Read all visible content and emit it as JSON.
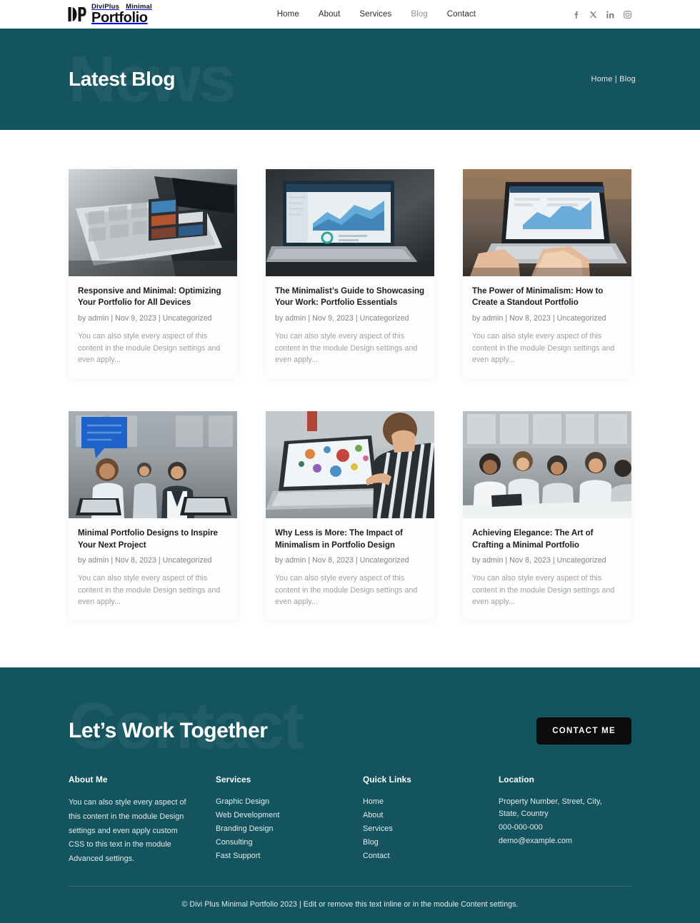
{
  "header": {
    "logo": {
      "mark": "ip-monogram-icon",
      "line1_a": "DiviPlus",
      "line1_b": "Minimal",
      "line2": "Portfolio"
    },
    "nav": [
      {
        "label": "Home",
        "active": false
      },
      {
        "label": "About",
        "active": false
      },
      {
        "label": "Services",
        "active": false
      },
      {
        "label": "Blog",
        "active": true
      },
      {
        "label": "Contact",
        "active": false
      }
    ],
    "socials": [
      {
        "name": "facebook-icon",
        "glyph": "f"
      },
      {
        "name": "x-twitter-icon",
        "glyph": "X"
      },
      {
        "name": "linkedin-icon",
        "glyph": "in"
      },
      {
        "name": "instagram-icon",
        "glyph": "◎"
      }
    ]
  },
  "hero": {
    "watermark": "News",
    "title": "Latest Blog",
    "breadcrumb": "Home | Blog"
  },
  "posts": [
    {
      "title": "Responsive and Minimal: Optimizing Your Portfolio for All Devices",
      "meta": "by admin | Nov 9, 2023 | Uncategorized",
      "excerpt": "You can also style every aspect of this content in the module Design settings and even apply...",
      "image": "tablet-on-laptop-photo"
    },
    {
      "title": "The Minimalist’s Guide to Showcasing Your Work: Portfolio Essentials",
      "meta": "by admin | Nov 9, 2023 | Uncategorized",
      "excerpt": "You can also style every aspect of this content in the module Design settings and even apply...",
      "image": "laptop-dashboard-analytics-photo"
    },
    {
      "title": "The Power of Minimalism: How to Create a Standout Portfolio",
      "meta": "by admin | Nov 8, 2023 | Uncategorized",
      "excerpt": "You can also style every aspect of this content in the module Design settings and even apply...",
      "image": "hands-typing-laptop-charts-photo"
    },
    {
      "title": "Minimal Portfolio Designs to Inspire Your Next Project",
      "meta": "by admin | Nov 8, 2023 | Uncategorized",
      "excerpt": "You can also style every aspect of this content in the module Design settings and even apply...",
      "image": "team-meeting-speech-bubble-photo"
    },
    {
      "title": "Why Less is More: The Impact of Minimalism in Portfolio Design",
      "meta": "by admin | Nov 8, 2023 | Uncategorized",
      "excerpt": "You can also style every aspect of this content in the module Design settings and even apply...",
      "image": "person-striped-shirt-laptop-photo"
    },
    {
      "title": "Achieving Elegance: The Art of Crafting a Minimal Portfolio",
      "meta": "by admin | Nov 8, 2023 | Uncategorized",
      "excerpt": "You can also style every aspect of this content in the module Design settings and even apply...",
      "image": "office-team-discussion-photo"
    }
  ],
  "cta": {
    "watermark": "Contact",
    "title": "Let’s Work Together",
    "button": "CONTACT ME"
  },
  "footer": {
    "about": {
      "heading": "About Me",
      "text": "You can also style every aspect of this content in the module Design settings and even apply custom CSS to this text in the module Advanced settings."
    },
    "services": {
      "heading": "Services",
      "items": [
        "Graphic Design",
        "Web Development",
        "Branding Design",
        "Consulting",
        "Fast Support"
      ]
    },
    "quick_links": {
      "heading": "Quick Links",
      "items": [
        "Home",
        "About",
        "Services",
        "Blog",
        "Contact"
      ]
    },
    "location": {
      "heading": "Location",
      "address": "Property Number, Street, City, State, Country",
      "phone": "000-000-000",
      "email": "demo@example.com"
    },
    "copyright": "© Divi Plus Minimal Portfolio 2023 | Edit or remove this text inline or in the module Content settings."
  },
  "colors": {
    "teal": "#14545f",
    "button_black": "#090b0c",
    "nav_active": "#8d9396"
  }
}
